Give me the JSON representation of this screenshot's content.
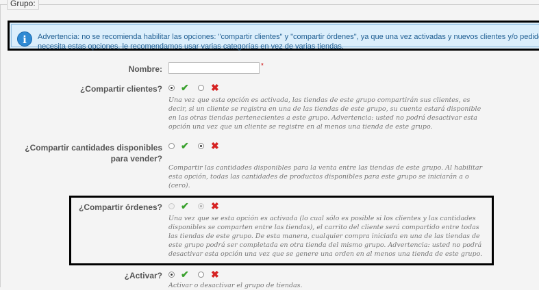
{
  "fieldset": {
    "legend": "Grupo:"
  },
  "warning": {
    "line1": "Advertencia: no se recomienda habilitar las opciones: \"compartir clientes\" y \"compartir órdenes\", ya que una vez activadas y nuevos clientes y/o pedidos",
    "line2": "necesita estas opciones, le recomendamos usar varias categorías en vez de varias tiendas."
  },
  "form": {
    "name": {
      "label": "Nombre:",
      "value": "",
      "required_mark": "*"
    },
    "share_customers": {
      "label": "¿Compartir clientes?",
      "selected": "yes",
      "desc": [
        "Una vez que esta opción es activada, las tiendas de este grupo compartirán sus clientes, es",
        "decir, si un cliente se registra en una de las tiendas de este grupo, su cuenta estará disponible",
        "en las otras tiendas pertenecientes a este grupo. Advertencia: usted no podrá desactivar esta",
        "opción una vez que un cliente se registre en al menos una tienda de este grupo."
      ]
    },
    "share_stock": {
      "label_line1": "¿Compartir cantidades disponibles",
      "label_line2": "para vender?",
      "selected": "no",
      "desc": [
        "Compartir las cantidades disponibles para la venta entre las tiendas de este grupo. Al habilitar",
        "esta opción, todas las cantidades de productos disponibles para este grupo se iniciarán a o",
        "(cero)."
      ]
    },
    "share_orders": {
      "label": "¿Compartir órdenes?",
      "selected": "no",
      "disabled": true,
      "desc": [
        "Una vez que se esta opción es activada (lo cual sólo es posible si los clientes y las cantidades",
        "disponibles se comparten entre las tiendas), el carrito del cliente será compartido entre todas",
        "las tiendas de este grupo. De esta manera, cualquier compra iniciada en una de las tiendas de",
        "este grupo podrá ser completada en otra tienda del mismo grupo. Advertencia: usted no podrá",
        "desactivar esta opción una vez que se genere una orden en al menos una tienda de este grupo."
      ]
    },
    "active": {
      "label": "¿Activar?",
      "selected": "yes",
      "desc": [
        "Activar o desactivar el grupo de tiendas."
      ]
    }
  },
  "icons": {
    "yes": "check-icon",
    "no": "cross-icon",
    "info": "info-icon"
  },
  "colors": {
    "yes": "#3aa12e",
    "no": "#d62323",
    "info": "#2f8ad3"
  }
}
